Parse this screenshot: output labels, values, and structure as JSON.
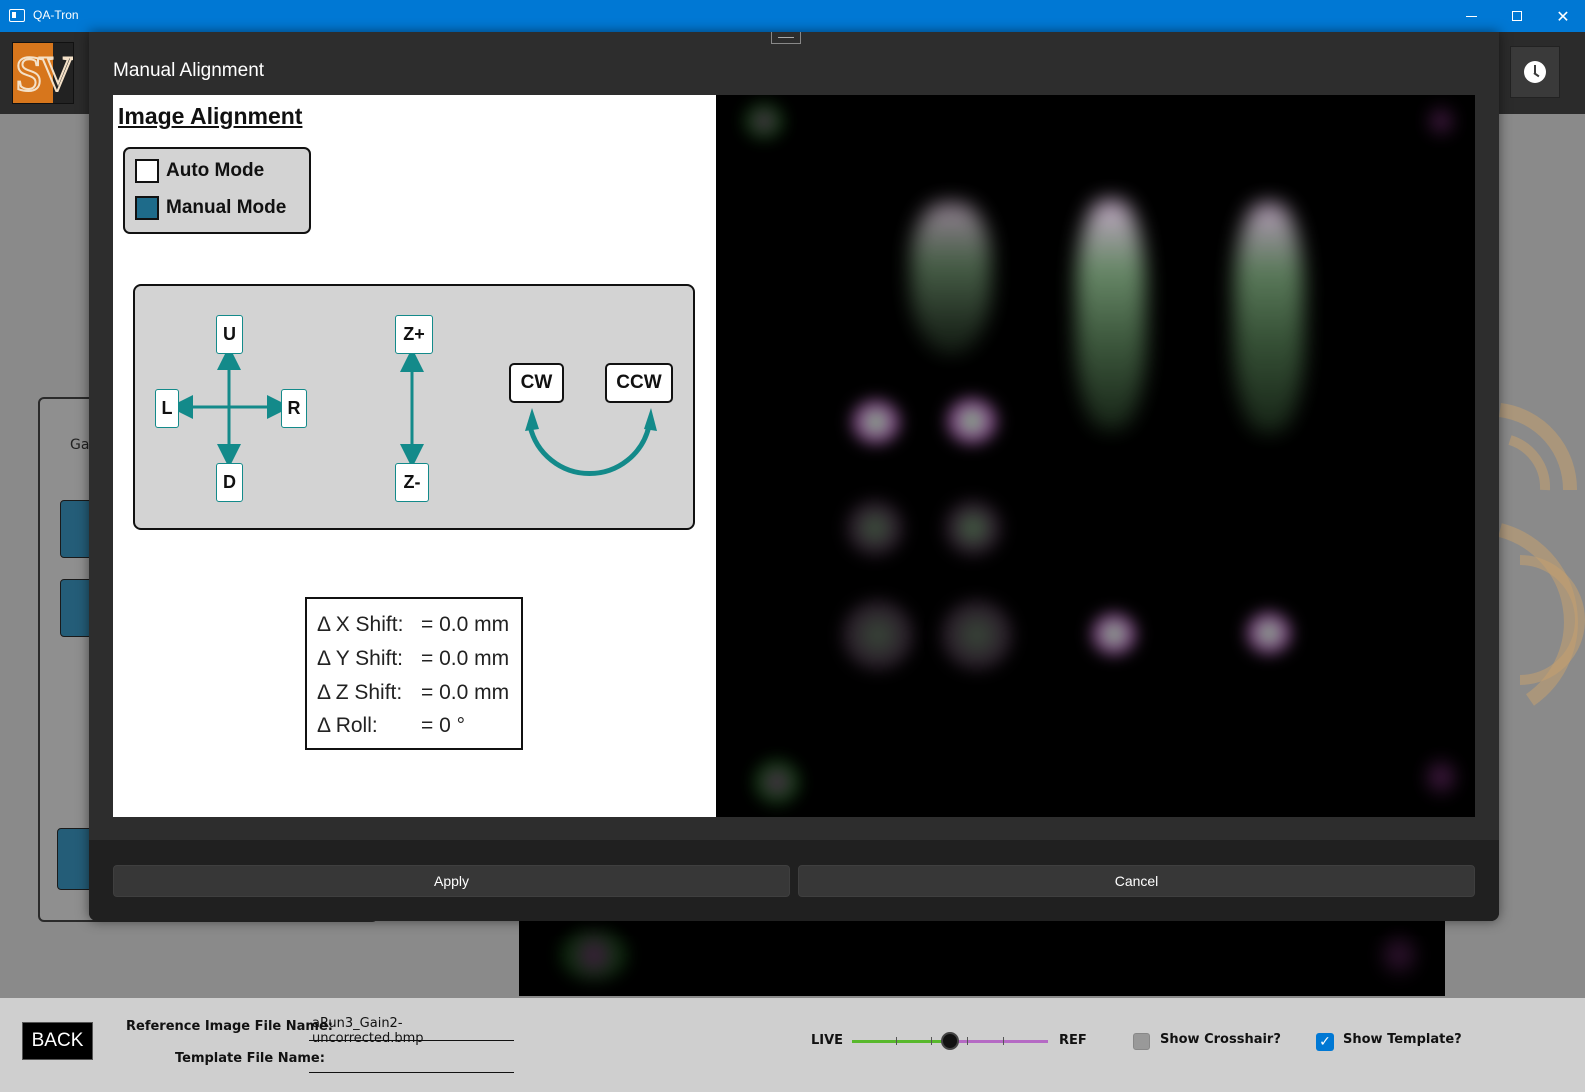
{
  "window": {
    "title": "QA-Tron",
    "minimize": "—",
    "maximize": "☐",
    "close": "✕"
  },
  "header": {
    "logo_text": "SV",
    "clock_icon": "clock-icon"
  },
  "background": {
    "panel_label": "Ga"
  },
  "dialog": {
    "title": "Manual Alignment",
    "section_title": "Image Alignment",
    "modes": {
      "auto_label": "Auto Mode",
      "auto_checked": false,
      "manual_label": "Manual Mode",
      "manual_checked": true
    },
    "jog": {
      "up": "U",
      "down": "D",
      "left": "L",
      "right": "R",
      "z_plus": "Z+",
      "z_minus": "Z-",
      "cw": "CW",
      "ccw": "CCW"
    },
    "shifts": {
      "x_label": "Δ X Shift:",
      "x_value": "= 0.0 mm",
      "y_label": "Δ Y Shift:",
      "y_value": "= 0.0 mm",
      "z_label": "Δ Z Shift:",
      "z_value": "= 0.0 mm",
      "roll_label": "Δ Roll:",
      "roll_value": "= 0 °"
    },
    "apply_label": "Apply",
    "cancel_label": "Cancel"
  },
  "bottom": {
    "back_label": "BACK",
    "ref_file_label": "Reference Image File Name:",
    "ref_file_value": "aRun3_Gain2-uncorrected.bmp",
    "template_file_label": "Template File Name:",
    "template_file_value": "",
    "live_label": "LIVE",
    "ref_label": "REF",
    "slider_value": 0.5,
    "show_crosshair_label": "Show Crosshair?",
    "show_crosshair_checked": false,
    "show_template_label": "Show Template?",
    "show_template_checked": true
  },
  "colors": {
    "titlebar": "#0078d4",
    "accent_teal": "#138a8a",
    "checkbox_fill": "#1e6b8a",
    "live_green": "#58b82c",
    "ref_purple": "#b56ac4"
  }
}
